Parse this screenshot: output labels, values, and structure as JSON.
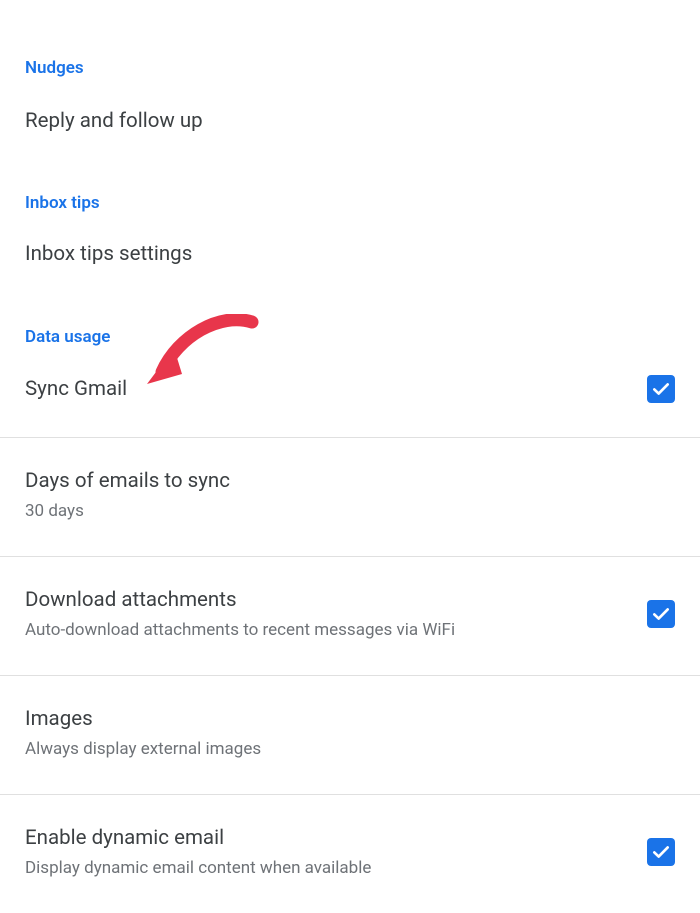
{
  "sections": {
    "nudges": {
      "header": "Nudges",
      "reply_follow_up": "Reply and follow up"
    },
    "inbox_tips": {
      "header": "Inbox tips",
      "settings": "Inbox tips settings"
    },
    "data_usage": {
      "header": "Data usage",
      "sync_gmail": {
        "title": "Sync Gmail",
        "checked": true
      },
      "days_to_sync": {
        "title": "Days of emails to sync",
        "value": "30 days"
      },
      "download_attachments": {
        "title": "Download attachments",
        "subtitle": "Auto-download attachments to recent messages via WiFi",
        "checked": true
      },
      "images": {
        "title": "Images",
        "subtitle": "Always display external images"
      },
      "dynamic_email": {
        "title": "Enable dynamic email",
        "subtitle": "Display dynamic email content when available",
        "checked": true
      }
    }
  },
  "annotation": {
    "arrow_color": "#e8364b"
  }
}
